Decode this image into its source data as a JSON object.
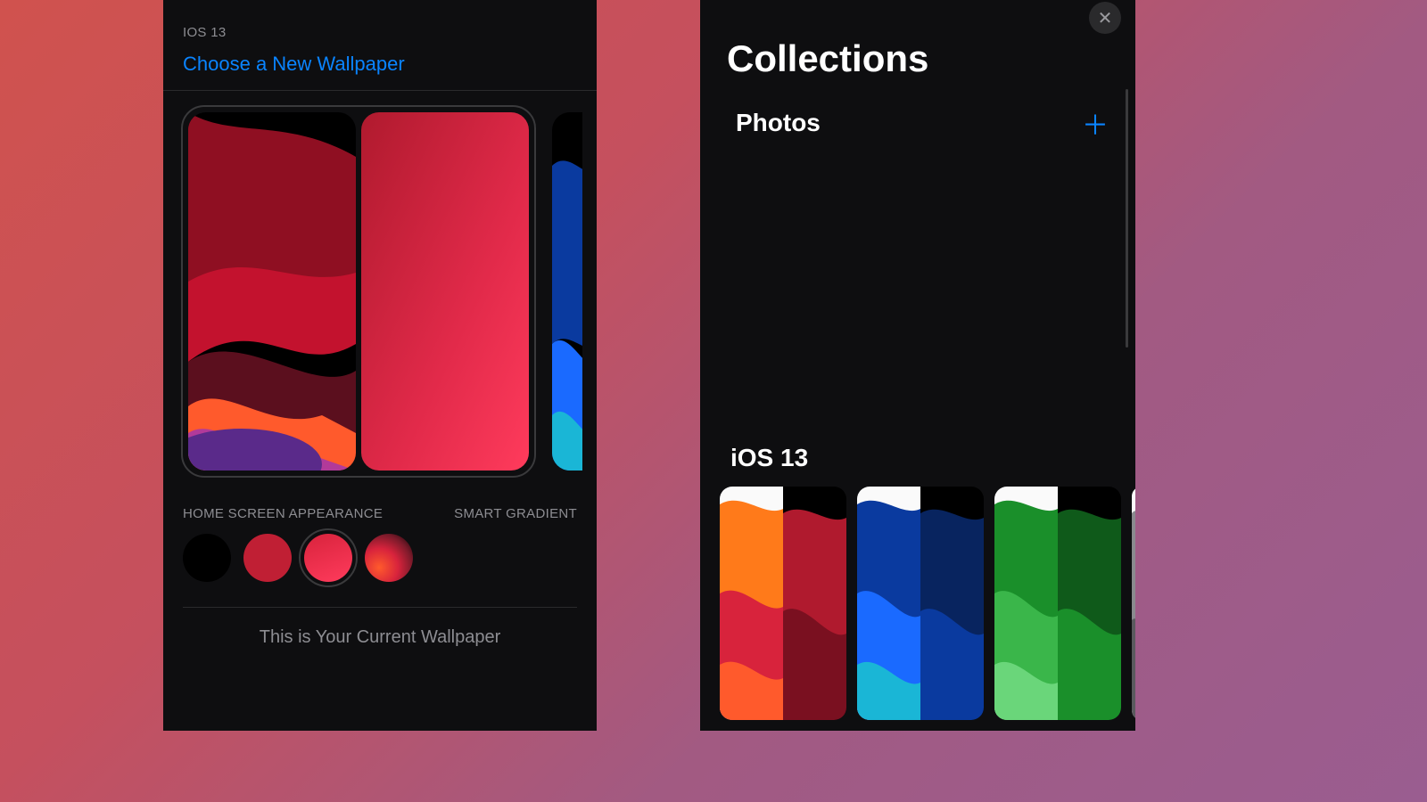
{
  "left": {
    "section_label": "IOS 13",
    "choose_link": "Choose a New Wallpaper",
    "appearance_label": "HOME SCREEN APPEARANCE",
    "smart_gradient_label": "SMART GRADIENT",
    "footer": "This is Your Current Wallpaper",
    "swatches": [
      {
        "name": "black"
      },
      {
        "name": "crimson"
      },
      {
        "name": "pink",
        "selected": true
      },
      {
        "name": "dynamic"
      }
    ]
  },
  "right": {
    "title": "Collections",
    "photos_label": "Photos",
    "ios13_label": "iOS 13",
    "thumbnails": [
      {
        "name": "red-orange"
      },
      {
        "name": "blue"
      },
      {
        "name": "green"
      },
      {
        "name": "grey"
      }
    ]
  },
  "colors": {
    "accent": "#0a84ff",
    "bg": "#0e0e10",
    "muted": "#8d8d92"
  }
}
